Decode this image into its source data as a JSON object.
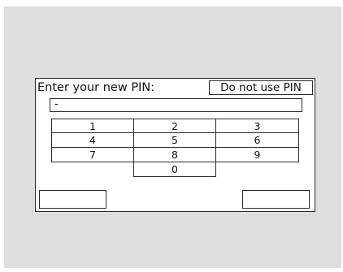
{
  "pin_dialog": {
    "prompt": "Enter your new PIN:",
    "do_not_use_pin_label": "Do not use PIN",
    "pin_value": "-",
    "keys": [
      "1",
      "2",
      "3",
      "4",
      "5",
      "6",
      "7",
      "8",
      "9",
      "0"
    ],
    "left_soft_key_label": "",
    "right_soft_key_label": ""
  }
}
